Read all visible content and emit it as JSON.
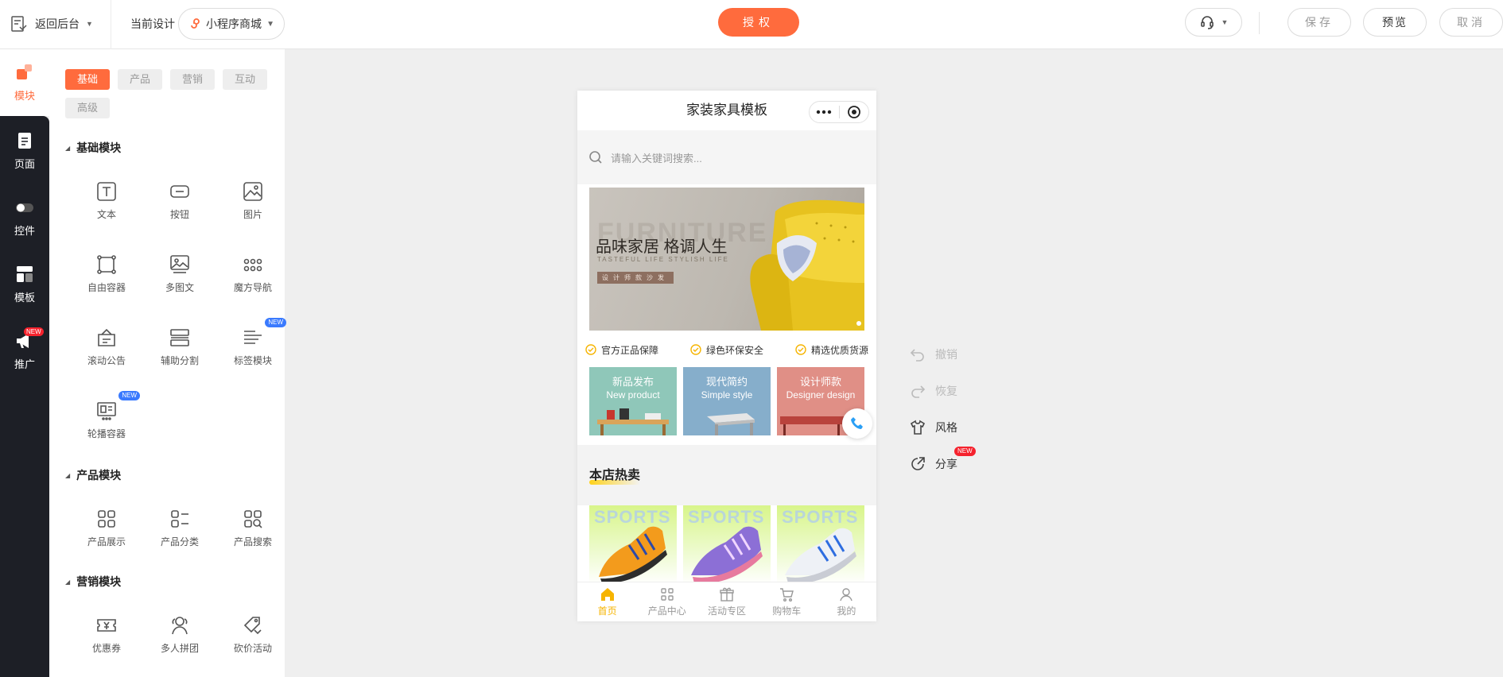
{
  "topbar": {
    "back_label": "返回后台",
    "current_design_label": "当前设计",
    "design_select_value": "小程序商城",
    "authorize_label": "授权",
    "save_label": "保存",
    "preview_label": "预览",
    "cancel_label": "取消"
  },
  "leftnav": {
    "items": [
      {
        "label": "模块",
        "icon": "module-icon",
        "active": true
      },
      {
        "label": "页面",
        "icon": "page-icon"
      },
      {
        "label": "控件",
        "icon": "toggle-icon"
      },
      {
        "label": "模板",
        "icon": "template-icon"
      },
      {
        "label": "推广",
        "icon": "megaphone-icon",
        "badge": "NEW"
      }
    ]
  },
  "modules": {
    "tabs": [
      "基础",
      "产品",
      "营销",
      "互动",
      "高级"
    ],
    "active_tab": "基础",
    "sections": [
      {
        "title": "基础模块",
        "items": [
          {
            "label": "文本",
            "icon": "text-icon"
          },
          {
            "label": "按钮",
            "icon": "button-icon"
          },
          {
            "label": "图片",
            "icon": "image-icon"
          },
          {
            "label": "自由容器",
            "icon": "free-container-icon"
          },
          {
            "label": "多图文",
            "icon": "multi-image-icon"
          },
          {
            "label": "魔方导航",
            "icon": "grid-nav-icon"
          },
          {
            "label": "滚动公告",
            "icon": "notice-icon"
          },
          {
            "label": "辅助分割",
            "icon": "divider-icon"
          },
          {
            "label": "标签模块",
            "icon": "tag-module-icon",
            "badge": "NEW"
          },
          {
            "label": "轮播容器",
            "icon": "carousel-icon",
            "badge": "NEW"
          }
        ]
      },
      {
        "title": "产品模块",
        "items": [
          {
            "label": "产品展示",
            "icon": "product-grid-icon"
          },
          {
            "label": "产品分类",
            "icon": "product-category-icon"
          },
          {
            "label": "产品搜索",
            "icon": "product-search-icon"
          }
        ]
      },
      {
        "title": "营销模块",
        "items": [
          {
            "label": "优惠券",
            "icon": "coupon-icon"
          },
          {
            "label": "多人拼团",
            "icon": "group-buy-icon"
          },
          {
            "label": "砍价活动",
            "icon": "bargain-icon"
          }
        ]
      }
    ]
  },
  "phone": {
    "title": "家装家具模板",
    "search_placeholder": "请输入关键词搜索...",
    "banner": {
      "ghost_text": "FURNITURE",
      "title": "品味家居 格调人生",
      "subtitle": "TASTEFUL LIFE STYLISH LIFE",
      "tag": "设计师款沙发"
    },
    "guarantees": [
      "官方正品保障",
      "绿色环保安全",
      "精选优质货源"
    ],
    "categories": [
      {
        "cn": "新品发布",
        "en": "New product",
        "color": "#8fc7b9"
      },
      {
        "cn": "现代简约",
        "en": "Simple style",
        "color": "#86aecb"
      },
      {
        "cn": "设计师款",
        "en": "Designer design",
        "color": "#e08f86"
      }
    ],
    "hot_title": "本店热卖",
    "products": [
      {
        "label": "SPORTS"
      },
      {
        "label": "SPORTS"
      },
      {
        "label": "SPORTS"
      }
    ],
    "tabbar": [
      {
        "label": "首页",
        "icon": "home-icon",
        "active": true
      },
      {
        "label": "产品中心",
        "icon": "product-center-icon"
      },
      {
        "label": "活动专区",
        "icon": "gift-icon"
      },
      {
        "label": "购物车",
        "icon": "cart-icon"
      },
      {
        "label": "我的",
        "icon": "user-icon"
      }
    ]
  },
  "actions": {
    "undo_label": "撤销",
    "redo_label": "恢复",
    "style_label": "风格",
    "share_label": "分享",
    "share_badge": "NEW"
  },
  "colors": {
    "accent": "#ff6b3d",
    "dark_nav": "#1d1f26",
    "tab_active": "#f6b400",
    "new_badge_blue": "#3a7afe",
    "new_badge_red": "#f5222d"
  }
}
